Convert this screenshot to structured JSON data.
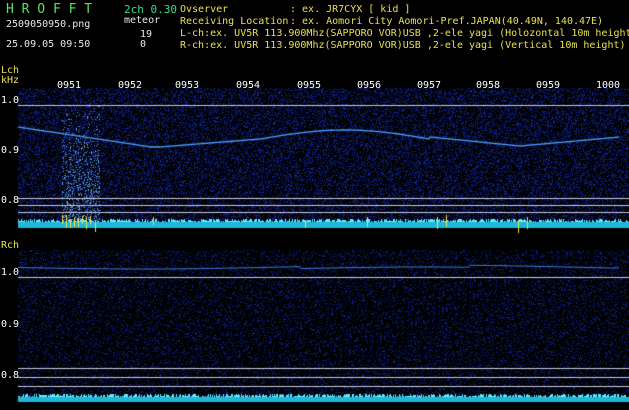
{
  "app": {
    "title": "H R O F F T",
    "version": "2ch 0.30"
  },
  "file": {
    "name": "2509050950.png",
    "datetime": "25.09.05 09:50"
  },
  "meteor": {
    "label": "meteor",
    "lch_count": "19",
    "rch_count": "0"
  },
  "info": {
    "observer_label": "Ovserver",
    "observer_value": ": ex. JR7CYX [ kid ]",
    "location_label": "Receiving Location",
    "location_value": ": ex. Aomori City Aomori-Pref.JAPAN(40.49N, 140.47E)",
    "lch_line": "L-ch:ex. UV5R 113.900Mhz(SAPPORO VOR)USB ,2-ele yagi (Holozontal 10m height)",
    "rch_line": "R-ch:ex. UV5R 113.900Mhz(SAPPORO VOR)USB ,2-ele yagi (Vertical 10m height)"
  },
  "panels": {
    "lch": {
      "name": "Lch",
      "unit": "kHz",
      "ticks": [
        "1.0",
        "0.9",
        "0.8"
      ]
    },
    "rch": {
      "name": "Rch",
      "ticks": [
        "1.0",
        "0.9",
        "0.8"
      ]
    }
  },
  "time_ticks": [
    "0951",
    "0952",
    "0953",
    "0954",
    "0955",
    "0956",
    "0957",
    "0958",
    "0959",
    "1000"
  ],
  "colors": {
    "background": "#000000",
    "noise": "#0a1a6a",
    "signal": "#4aa0ff",
    "baseline": "#33e8ff",
    "meteor": "#e8e050",
    "guide": "#c8c8d8"
  }
}
